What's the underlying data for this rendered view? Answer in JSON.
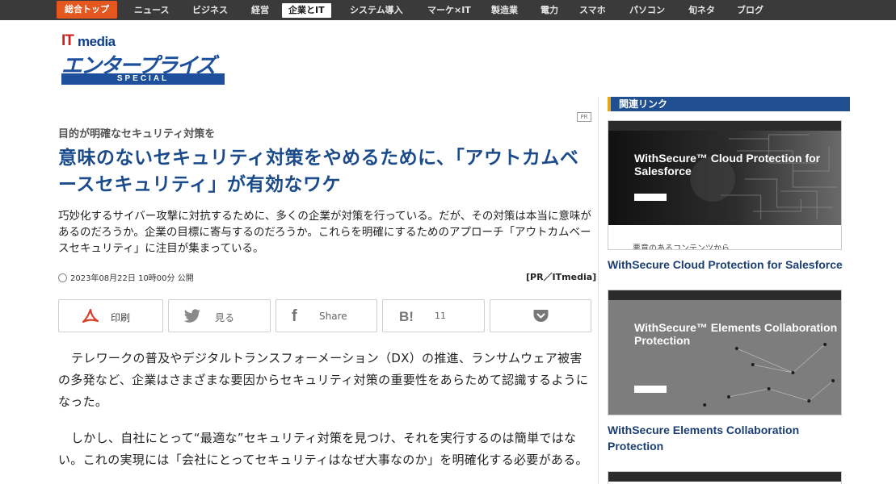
{
  "nav": {
    "items": [
      {
        "label": "総合トップ"
      },
      {
        "label": "ニュース"
      },
      {
        "label": "ビジネス"
      },
      {
        "label": "経営"
      },
      {
        "label": "企業とIT"
      },
      {
        "label": "システム導入"
      },
      {
        "label": "マーケ×IT"
      },
      {
        "label": "製造業"
      },
      {
        "label": "電力"
      },
      {
        "label": "スマホ"
      },
      {
        "label": "パソコン"
      },
      {
        "label": "旬ネタ"
      },
      {
        "label": "ブログ"
      }
    ],
    "active_index": 4,
    "colors": {
      "bar": "#3a3a3a",
      "home": "#e4571f"
    }
  },
  "logo": {
    "it": "IT",
    "media": "media",
    "main": "エンタープライズ",
    "band": "SPECIAL"
  },
  "article": {
    "pr_badge": "PR",
    "subtitle": "目的が明確なセキュリティ対策を",
    "title": "意味のないセキュリティ対策をやめるために、「アウトカムベースセキュリティ」が有効なワケ",
    "lead": "巧妙化するサイバー攻撃に対抗するために、多くの企業が対策を行っている。だが、その対策は本当に意味があるのだろうか。企業の目標に寄与するのだろうか。これらを明確にするためのアプローチ「アウトカムベースセキュリティ」に注目が集まっている。",
    "date": "2023年08月22日 10時00分 公開",
    "source": "[PR／ITmedia]",
    "share": {
      "print_label": "印刷",
      "twitter_label": "見る",
      "facebook_label": "Share",
      "hatena_count": "11",
      "hatena_icon": "B!",
      "facebook_icon": "f"
    },
    "paragraphs": [
      "テレワークの普及やデジタルトランスフォーメーション（DX）の推進、ランサムウェア被害の多発など、企業はさまざまな要因からセキュリティ対策の重要性をあらためて認識するようになった。",
      "しかし、自社にとって“最適な”セキュリティ対策を見つけ、それを実行するのは簡単ではない。これの実現には「会社にとってセキュリティはなぜ大事なのか」を明確化する必要がある。"
    ]
  },
  "sidebar": {
    "heading": "関連リンク",
    "links": [
      {
        "thumb_title": "WithSecure™ Cloud Protection for Salesforce",
        "thumb_note": "悪意のあるコンテンツから",
        "label": "WithSecure Cloud Protection for Salesforce"
      },
      {
        "thumb_title": "WithSecure™ Elements Collaboration Protection",
        "label": "WithSecure Elements Collaboration Protection"
      }
    ],
    "accent_colors": {
      "heading_bg": "#1f4f91",
      "heading_bar": "#e8a417",
      "link": "#1b3f73"
    }
  }
}
